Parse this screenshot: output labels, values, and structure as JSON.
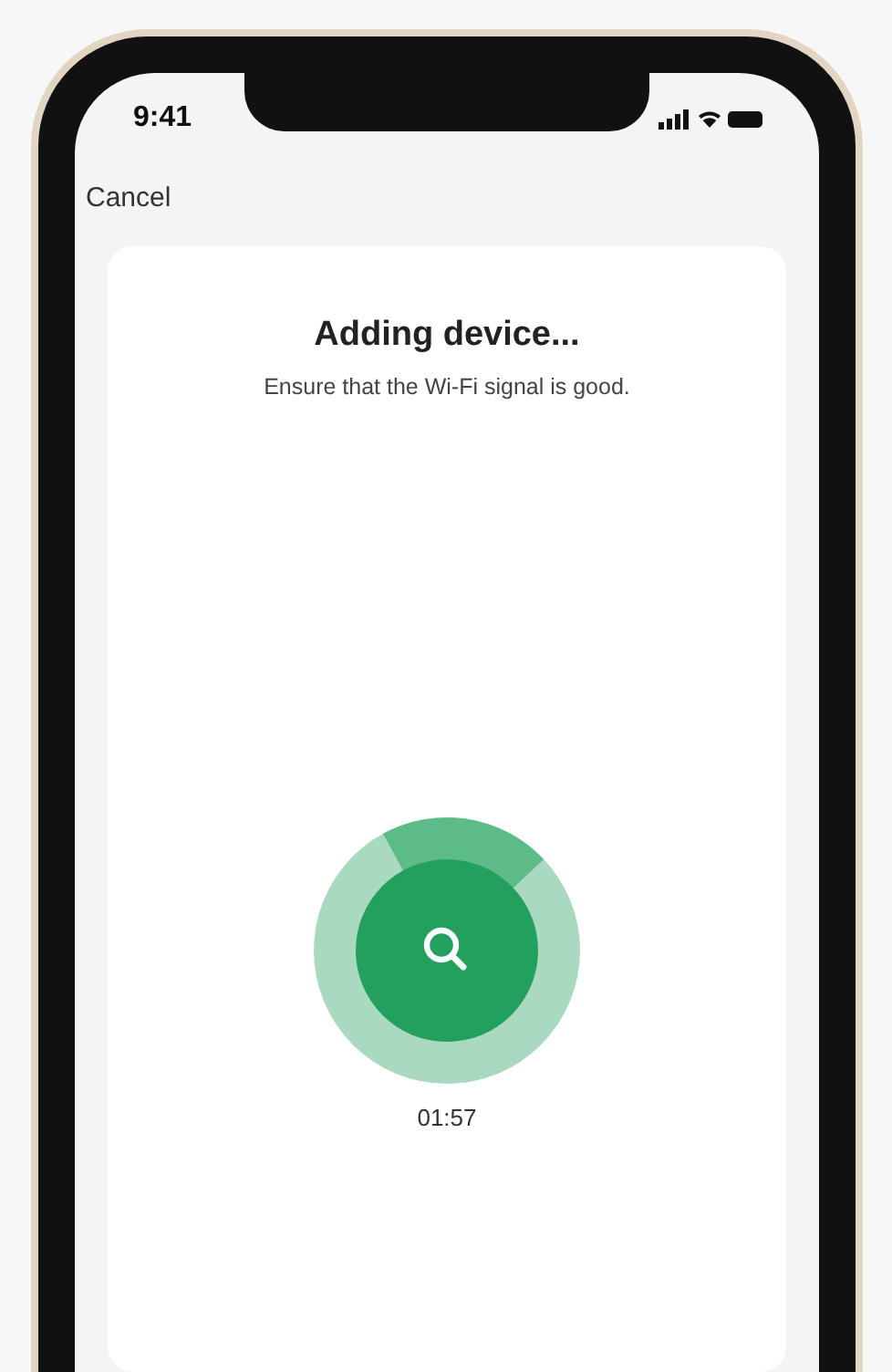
{
  "status_bar": {
    "time": "9:41"
  },
  "header": {
    "cancel": "Cancel"
  },
  "card": {
    "title": "Adding device...",
    "subtitle": "Ensure that the Wi-Fi signal is good."
  },
  "progress": {
    "timer": "01:57"
  }
}
